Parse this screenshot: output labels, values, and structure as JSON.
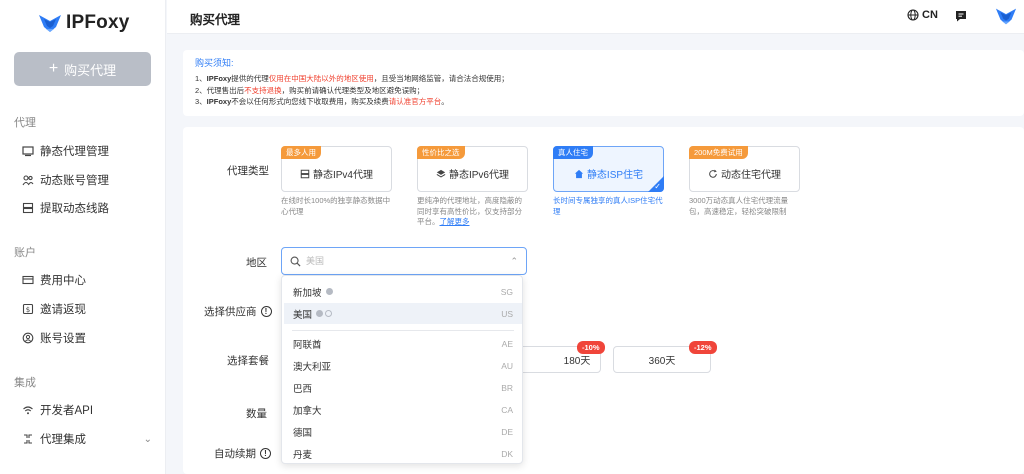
{
  "app": {
    "logo_text": "IPFoxy"
  },
  "header": {
    "title": "购买代理",
    "lang": "CN"
  },
  "sidebar": {
    "buy_button": "购买代理",
    "sections": [
      {
        "title": "代理",
        "items": [
          "静态代理管理",
          "动态账号管理",
          "提取动态线路"
        ]
      },
      {
        "title": "账户",
        "items": [
          "费用中心",
          "邀请返现",
          "账号设置"
        ]
      },
      {
        "title": "集成",
        "items": [
          "开发者API",
          "代理集成"
        ]
      }
    ]
  },
  "notice": {
    "title": "购买须知:",
    "line1_a": "1、",
    "line1_b": "IPFoxy",
    "line1_c": "提供的代理",
    "line1_red": "仅用在中国大陆以外的地区使用",
    "line1_d": "，且受当地网络监管，请合法合规使用；",
    "line2_a": "2、代理售出后",
    "line2_red": "不支持退换",
    "line2_b": "，购买前请确认代理类型及地区避免误购；",
    "line3_a": "3、",
    "line3_b": "IPFoxy",
    "line3_c": "不会以任何形式向您线下收取费用，购买及续费",
    "line3_red": "请认准官方平台",
    "line3_d": "。"
  },
  "form": {
    "proxy_type_label": "代理类型",
    "region_label": "地区",
    "supplier_label": "选择供应商",
    "package_label": "选择套餐",
    "quantity_label": "数量",
    "auto_renew_label": "自动续期"
  },
  "proxy_types": [
    {
      "badge": "最多人用",
      "name": "静态IPv4代理",
      "desc": "在线时长100%的独享静态数据中心代理"
    },
    {
      "badge": "性价比之选",
      "name": "静态IPv6代理",
      "desc": "更纯净的代理地址，高度隐蔽的同时享有高性价比，仅支持部分平台。",
      "link": "了解更多"
    },
    {
      "badge": "真人住宅",
      "name": "静态ISP住宅",
      "desc": "长时间专属独享的真人ISP住宅代理"
    },
    {
      "badge": "200M免费试用",
      "name": "动态住宅代理",
      "desc": "3000万动态真人住宅代理流量包，高速稳定，轻松突破限制"
    }
  ],
  "region": {
    "placeholder": "美国",
    "options": [
      {
        "name": "新加坡",
        "code": "SG"
      },
      {
        "name": "美国",
        "code": "US"
      },
      {
        "name": "阿联酋",
        "code": "AE"
      },
      {
        "name": "澳大利亚",
        "code": "AU"
      },
      {
        "name": "巴西",
        "code": "BR"
      },
      {
        "name": "加拿大",
        "code": "CA"
      },
      {
        "name": "德国",
        "code": "DE"
      },
      {
        "name": "丹麦",
        "code": "DK"
      }
    ]
  },
  "periods": [
    {
      "label": "180天",
      "discount": "-10%"
    },
    {
      "label": "360天",
      "discount": "-12%"
    }
  ],
  "colors": {
    "accent": "#2f7df6",
    "warning": "#f59a3b",
    "danger": "#f0412f"
  }
}
